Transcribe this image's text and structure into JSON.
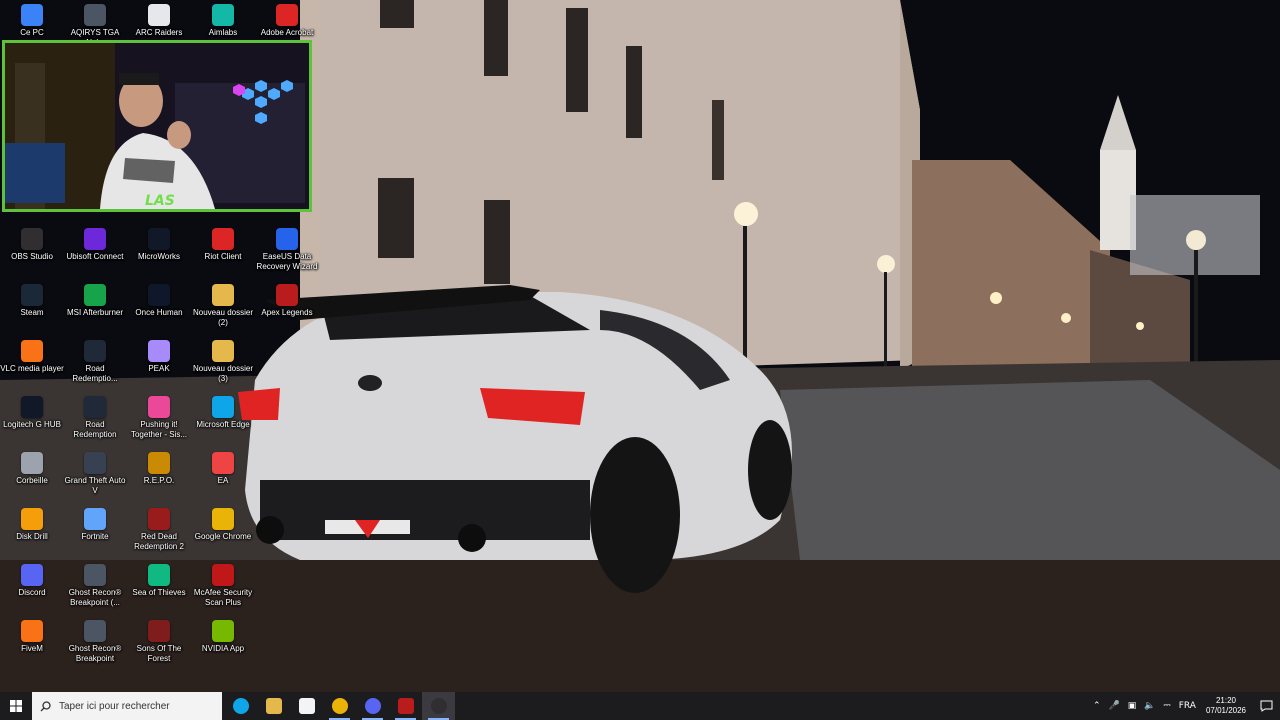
{
  "desktop": {
    "icons": [
      {
        "label": "Ce PC",
        "icon": "computer-icon",
        "color": "#3b82f6"
      },
      {
        "label": "AQIRYS TGA Alpha",
        "icon": "aqirys-icon",
        "color": "#4b5563"
      },
      {
        "label": "ARC Raiders",
        "icon": "document-icon",
        "color": "#e5e7eb"
      },
      {
        "label": "Aimlabs",
        "icon": "aimlabs-icon",
        "color": "#14b8a6"
      },
      {
        "label": "Adobe Acrobat",
        "icon": "acrobat-icon",
        "color": "#dc2626"
      },
      {
        "label": "OBS Studio",
        "icon": "obs-icon",
        "color": "#302e31"
      },
      {
        "label": "Ubisoft Connect",
        "icon": "ubisoft-icon",
        "color": "#6d28d9"
      },
      {
        "label": "MicroWorks",
        "icon": "microworks-icon",
        "color": "#111827"
      },
      {
        "label": "Riot Client",
        "icon": "riot-icon",
        "color": "#dc2626"
      },
      {
        "label": "EaseUS Data Recovery Wizard",
        "icon": "easeus-icon",
        "color": "#2563eb"
      },
      {
        "label": "Steam",
        "icon": "steam-icon",
        "color": "#1b2838"
      },
      {
        "label": "MSI Afterburner",
        "icon": "afterburner-icon",
        "color": "#16a34a"
      },
      {
        "label": "Once Human",
        "icon": "oncehuman-icon",
        "color": "#0f172a"
      },
      {
        "label": "Nouveau dossier (2)",
        "icon": "folder-icon",
        "color": "#e5b84b"
      },
      {
        "label": "Apex Legends",
        "icon": "apex-icon",
        "color": "#b91c1c"
      },
      {
        "label": "VLC media player",
        "icon": "vlc-icon",
        "color": "#f97316"
      },
      {
        "label": "Road Redemptio...",
        "icon": "roadredemption-icon",
        "color": "#1f2937"
      },
      {
        "label": "PEAK",
        "icon": "peak-icon",
        "color": "#a78bfa"
      },
      {
        "label": "Nouveau dossier (3)",
        "icon": "folder-icon",
        "color": "#e5b84b"
      },
      {
        "label": "Logitech G HUB",
        "icon": "ghub-icon",
        "color": "#111827"
      },
      {
        "label": "Road Redemption",
        "icon": "roadredemption-icon",
        "color": "#1f2937"
      },
      {
        "label": "Pushing it! Together - Sis...",
        "icon": "pushingit-icon",
        "color": "#ec4899"
      },
      {
        "label": "Microsoft Edge",
        "icon": "edge-icon",
        "color": "#0ea5e9"
      },
      {
        "label": "Corbeille",
        "icon": "recycle-bin-icon",
        "color": "#9ca3af"
      },
      {
        "label": "Grand Theft Auto V",
        "icon": "gta-icon",
        "color": "#374151"
      },
      {
        "label": "R.E.P.O.",
        "icon": "repo-icon",
        "color": "#ca8a04"
      },
      {
        "label": "EA",
        "icon": "ea-icon",
        "color": "#ef4444"
      },
      {
        "label": "Disk Drill",
        "icon": "diskdrill-icon",
        "color": "#f59e0b"
      },
      {
        "label": "Fortnite",
        "icon": "fortnite-icon",
        "color": "#60a5fa"
      },
      {
        "label": "Red Dead Redemption 2",
        "icon": "rdr2-icon",
        "color": "#991b1b"
      },
      {
        "label": "Google Chrome",
        "icon": "chrome-icon",
        "color": "#eab308"
      },
      {
        "label": "Discord",
        "icon": "discord-icon",
        "color": "#5865f2"
      },
      {
        "label": "Ghost Recon® Breakpoint (...",
        "icon": "ghostrecon-icon",
        "color": "#4b5563"
      },
      {
        "label": "Sea of Thieves",
        "icon": "seaofthieves-icon",
        "color": "#10b981"
      },
      {
        "label": "McAfee Security Scan Plus",
        "icon": "mcafee-icon",
        "color": "#c01818"
      },
      {
        "label": "FiveM",
        "icon": "fivem-icon",
        "color": "#f97316"
      },
      {
        "label": "Ghost Recon® Breakpoint",
        "icon": "ghostrecon-icon",
        "color": "#4b5563"
      },
      {
        "label": "Sons Of The Forest",
        "icon": "sonsoftheforest-icon",
        "color": "#7f1d1d"
      },
      {
        "label": "NVIDIA App",
        "icon": "nvidia-icon",
        "color": "#76b900"
      }
    ]
  },
  "webcam": {
    "logo": "LAS"
  },
  "taskbar": {
    "search_placeholder": "Taper ici pour rechercher",
    "apps": [
      {
        "name": "edge",
        "icon": "edge-icon",
        "color": "#0ea5e9",
        "glyph": "e"
      },
      {
        "name": "file-explorer",
        "icon": "folder-icon",
        "color": "#e5b84b",
        "glyph": ""
      },
      {
        "name": "store",
        "icon": "store-icon",
        "color": "#f3f4f6",
        "glyph": ""
      },
      {
        "name": "chrome",
        "icon": "chrome-icon",
        "color": "#eab308",
        "glyph": ""
      },
      {
        "name": "discord",
        "icon": "discord-icon",
        "color": "#5865f2",
        "glyph": ""
      },
      {
        "name": "voicemeeter",
        "icon": "voicemeeter-icon",
        "color": "#b91c1c",
        "glyph": ""
      },
      {
        "name": "obs",
        "icon": "obs-icon",
        "color": "#302e31",
        "glyph": ""
      }
    ],
    "tray": {
      "language": "FRA",
      "time": "21:20",
      "date": "07/01/2026"
    }
  }
}
